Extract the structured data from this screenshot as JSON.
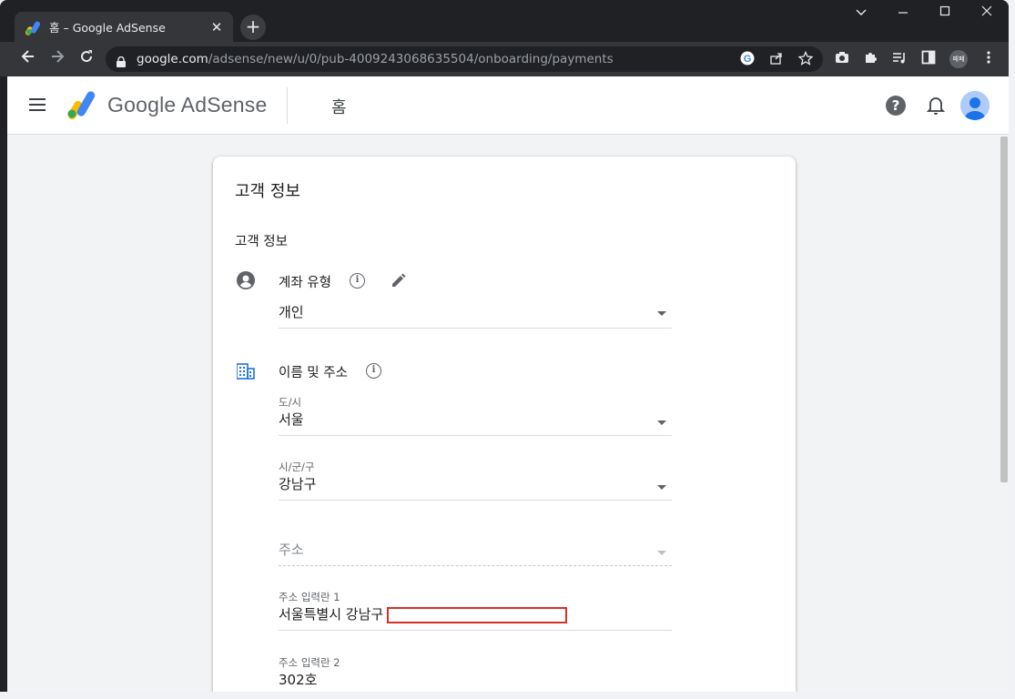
{
  "browser": {
    "tab_title": "홈 – Google AdSense",
    "tab_close": "✕",
    "new_tab": "+",
    "url_host": "google.com",
    "url_path": "/adsense/new/u/0/pub-4009243068635504/onboarding/payments",
    "profile_label": "페페"
  },
  "app": {
    "brand": "Google AdSense",
    "section": "홈"
  },
  "card": {
    "title": "고객 정보",
    "subtitle": "고객 정보",
    "account_type": {
      "label": "계좌 유형",
      "value": "개인"
    },
    "name_address": {
      "label": "이름 및 주소",
      "province": {
        "label": "도/시",
        "value": "서울"
      },
      "district": {
        "label": "시/군/구",
        "value": "강남구"
      },
      "address": {
        "placeholder": "주소"
      },
      "address1": {
        "label": "주소 입력란 1",
        "value": "서울특별시 강남구"
      },
      "address2": {
        "label": "주소 입력란 2",
        "value": "302호"
      }
    }
  },
  "colors": {
    "accent_blue": "#1a73e8",
    "redaction_red": "#d93025"
  },
  "icons": {
    "account": "account-circle-icon",
    "building": "building-icon",
    "info": "info-icon",
    "edit": "pencil-icon"
  }
}
